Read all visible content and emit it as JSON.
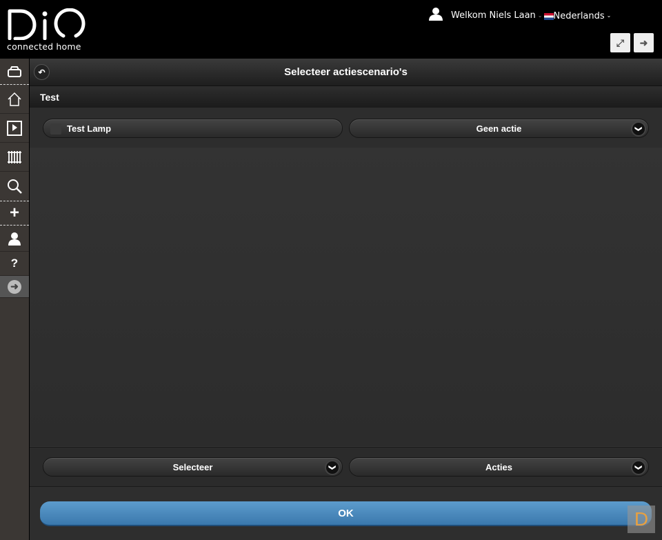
{
  "header": {
    "logo_text": "DiO",
    "logo_subtitle": "connected home",
    "welcome": "Welkom Niels Laan",
    "language": "Nederlands",
    "icons": [
      "user-icon",
      "fullscreen-icon",
      "logout-icon"
    ]
  },
  "sidebar": {
    "items": [
      "devices",
      "home",
      "media",
      "heating",
      "search",
      "add",
      "user",
      "help",
      "next"
    ]
  },
  "page": {
    "title": "Selecteer actiescenario's",
    "section": "Test",
    "device_name": "Test Lamp",
    "device_action": "Geen actie",
    "select_label": "Selecteer",
    "actions_label": "Acties",
    "ok_label": "OK",
    "badge": "D"
  },
  "colors": {
    "accent": "#4a8bc0",
    "header_bg": "#000000",
    "sidebar_bg": "#3b3734"
  }
}
